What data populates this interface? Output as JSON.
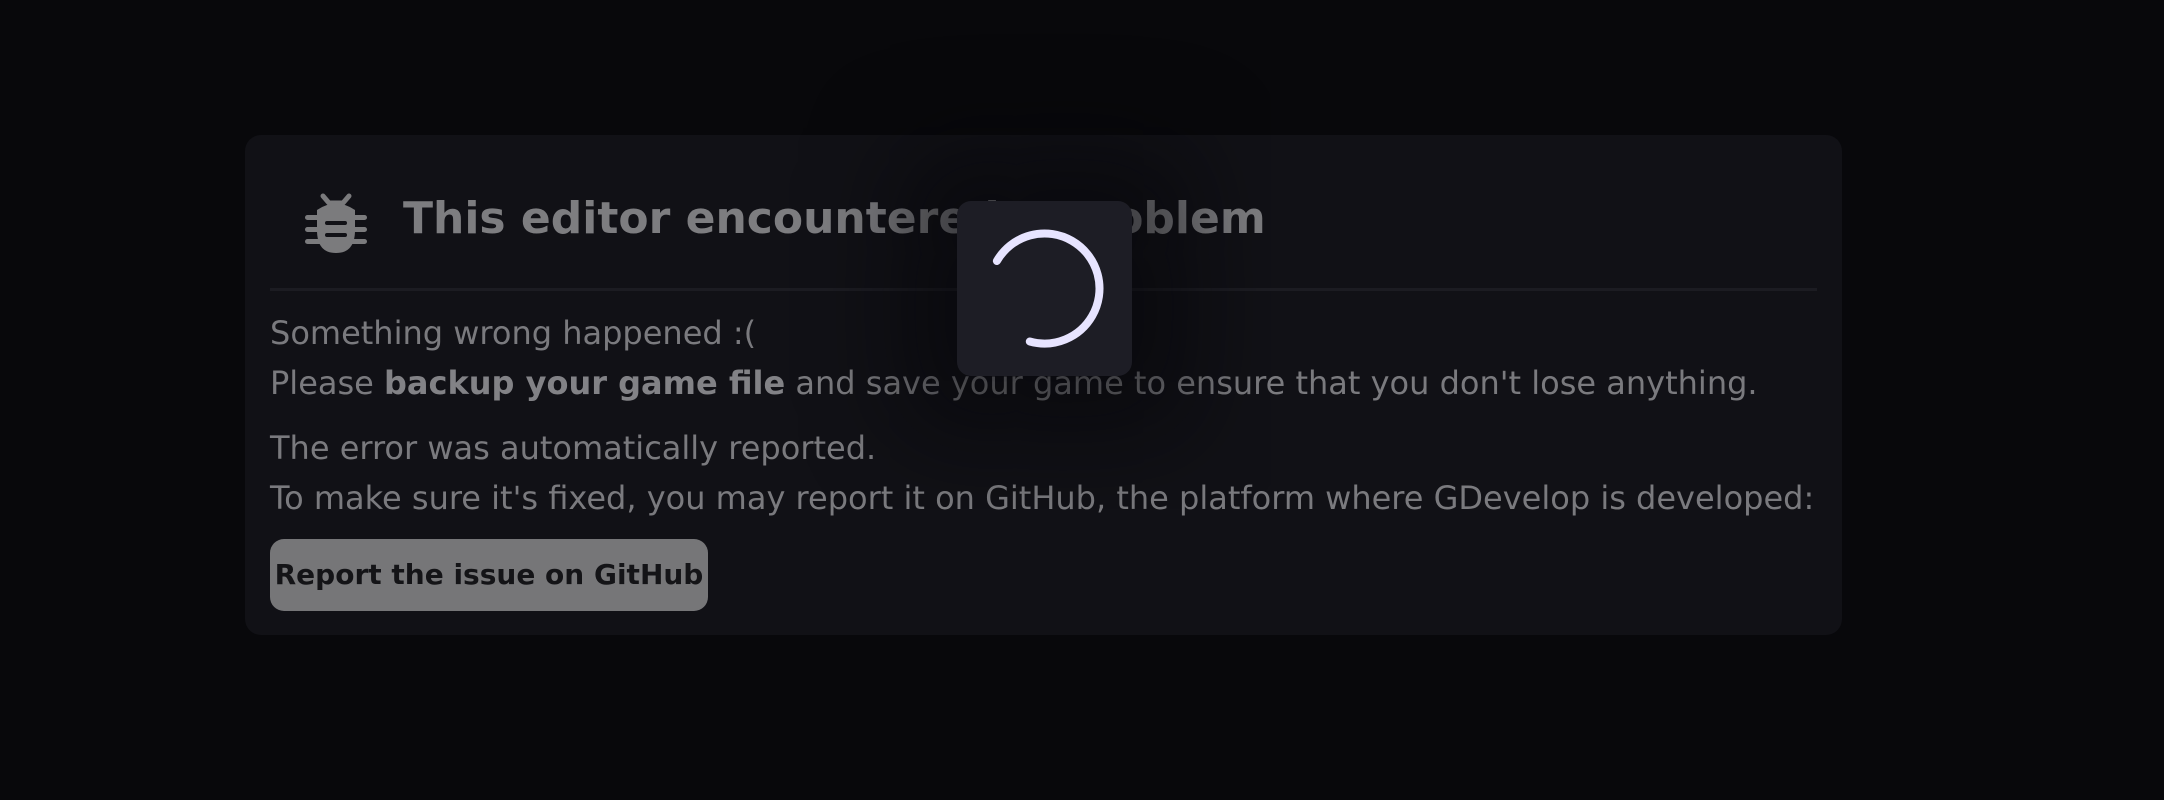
{
  "error_card": {
    "title": "This editor encountered a problem",
    "icon": "bug-icon",
    "message_line1": "Something wrong happened :(",
    "message_line2_prefix": "Please ",
    "message_line2_bold": "backup your game file",
    "message_line2_suffix": " and save your game to ensure that you don't lose anything.",
    "reported_line": "The error was automatically reported.",
    "github_line": "To make sure it's fixed, you may report it on GitHub, the platform where GDevelop is developed:",
    "report_button_label": "Report the issue on GitHub"
  },
  "loading_overlay": {
    "icon": "loading-spinner-icon",
    "spinner_color": "#e7e4ff"
  },
  "colors": {
    "background": "#08080b",
    "card": "#111116",
    "text": "#7a7a7e",
    "button": "#767678"
  }
}
